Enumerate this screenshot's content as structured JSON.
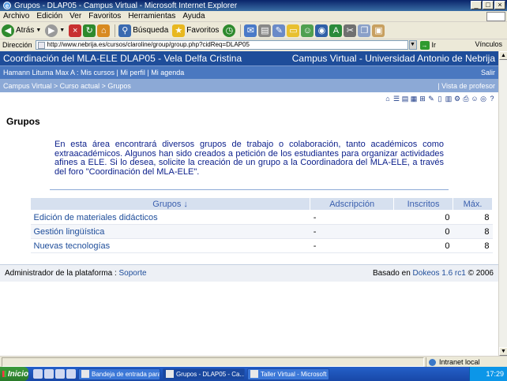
{
  "window": {
    "title": "Grupos - DLAP05 - Campus Virtual - Microsoft Internet Explorer"
  },
  "menu": [
    "Archivo",
    "Edición",
    "Ver",
    "Favoritos",
    "Herramientas",
    "Ayuda"
  ],
  "toolbar": {
    "back_label": "Atrás",
    "search_label": "Búsqueda",
    "favorites_label": "Favoritos"
  },
  "address": {
    "label": "Dirección",
    "url": "http://www.nebrija.es/cursos/claroline/group/group.php?cidReq=DLAP05",
    "go_label": "Ir",
    "links_label": "Vínculos"
  },
  "site": {
    "course_title": "Coordinación del MLA-ELE DLAP05 - Vela Delfa Cristina",
    "campus_title": "Campus Virtual - Universidad Antonio de Nebrija",
    "user_nav": "Hamann Lituma Max A : Mis cursos | Mi perfil | Mi agenda",
    "logout": "Salir",
    "breadcrumb": "Campus Virtual > Curso actual > Grupos",
    "teacher_view": "| Vista de profesor"
  },
  "main": {
    "title": "Grupos",
    "intro": "En esta área encontrará diversos grupos de trabajo o colaboración, tanto académicos como extraacadémicos. Algunos han sido creados a petición de los estudiantes para organizar actividades afines a ELE. Si lo desea, solicite la creación de un grupo a la Coordinadora del MLA-ELE, a través del foro \"Coordinación del MLA-ELE\"."
  },
  "table": {
    "headers": [
      "Grupos ↓",
      "Adscripción",
      "Inscritos",
      "Máx."
    ],
    "rows": [
      {
        "name": "Edición de materiales didácticos",
        "adscripcion": "-",
        "inscritos": "0",
        "max": "8"
      },
      {
        "name": "Gestión lingüística",
        "adscripcion": "-",
        "inscritos": "0",
        "max": "8"
      },
      {
        "name": "Nuevas tecnologías",
        "adscripcion": "-",
        "inscritos": "0",
        "max": "8"
      }
    ]
  },
  "footer": {
    "admin_label": "Administrador de la plataforma :",
    "admin_link": "Soporte",
    "based_on": "Basado en",
    "product": "Dokeos 1.6 rc1",
    "copyright": "© 2006"
  },
  "status": {
    "zone": "Intranet local"
  },
  "taskbar": {
    "start": "Inicio",
    "tasks": [
      "Bandeja de entrada para ...",
      "Grupos - DLAP05 - Ca...",
      "Taller Virtual - Microsoft ..."
    ],
    "clock": "17:29"
  },
  "colors": {
    "header_dark": "#1e4d9a",
    "header_mid": "#4a78c0",
    "header_light": "#8ca9d6",
    "intro_text": "#0a1e8a"
  }
}
